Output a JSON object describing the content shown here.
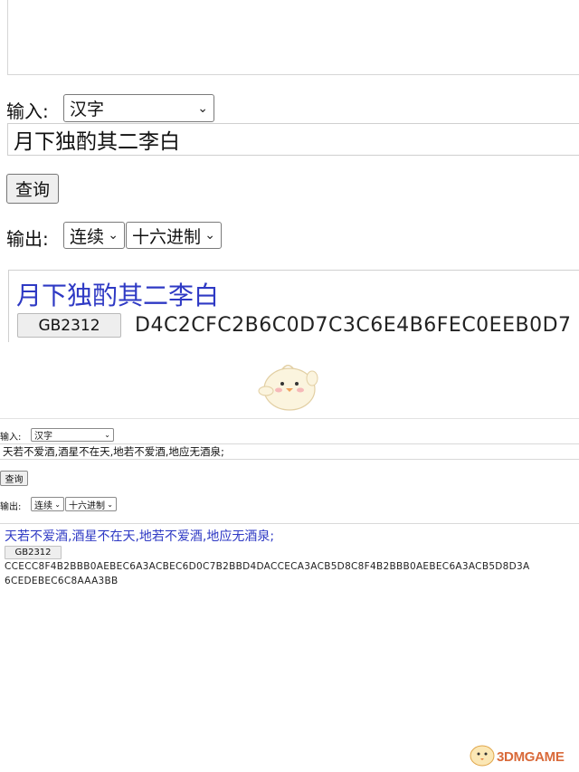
{
  "top": {
    "input_label": "输入:",
    "input_type_selected": "汉字",
    "input_text": "月下独酌其二李白",
    "query_button": "查询",
    "output_label": "输出:",
    "output_mode_selected": "连续",
    "output_base_selected": "十六进制",
    "result_text": "月下独酌其二李白",
    "encoding_label": "GB2312",
    "hex_output": "D4C2CFC2B6C0D7C3C6E4B6FEC0EEB0D7"
  },
  "bottom": {
    "input_label": "输入:",
    "input_type_selected": "汉字",
    "input_text": "天若不爱酒,酒星不在天,地若不爱酒,地应无酒泉;",
    "query_button": "查询",
    "output_label": "输出:",
    "output_mode_selected": "连续",
    "output_base_selected": "十六进制",
    "result_text": "天若不爱酒,酒星不在天,地若不爱酒,地应无酒泉;",
    "encoding_label": "GB2312",
    "hex_output_line1": "CCECC8F4B2BBB0AEBEC6A3ACBEC6D0C7B2BBD4DACCECA3ACB5D8C8F4B2BBB0AEBEC6A3ACB5D8D3A",
    "hex_output_line2": "6CEDEBEC6C8AAA3BB"
  },
  "watermark": {
    "text": "3DMGAME"
  },
  "colors": {
    "result_blue": "#2e39c4",
    "watermark_orange": "#d96a3a"
  },
  "icons": {
    "dropdown": "chevron-down-icon",
    "mascot": "chick-mascot-icon"
  }
}
